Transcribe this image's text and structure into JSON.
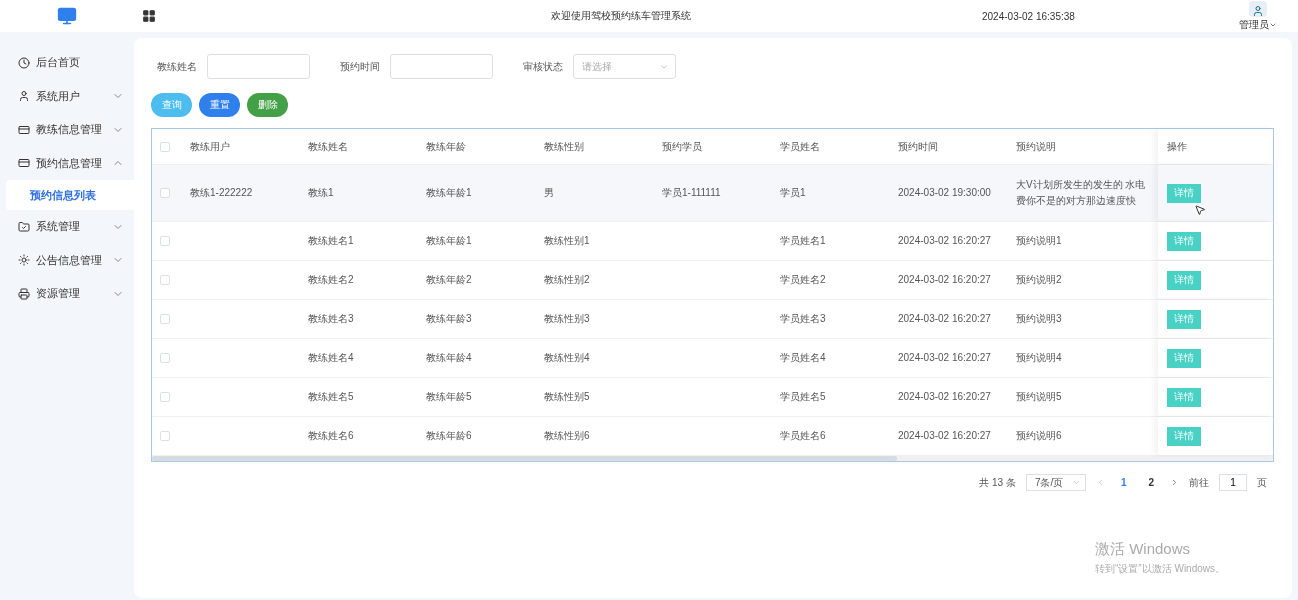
{
  "header": {
    "title": "欢迎使用驾校预约练车管理系统",
    "datetime": "2024-03-02 16:35:38",
    "user": "管理员"
  },
  "sidebar": {
    "items": [
      {
        "label": "后台首页"
      },
      {
        "label": "系统用户",
        "expanded": false
      },
      {
        "label": "教练信息管理",
        "expanded": false
      },
      {
        "label": "预约信息管理",
        "expanded": true,
        "children": [
          {
            "label": "预约信息列表",
            "selected": true
          }
        ]
      },
      {
        "label": "系统管理",
        "expanded": false
      },
      {
        "label": "公告信息管理",
        "expanded": false
      },
      {
        "label": "资源管理",
        "expanded": false
      }
    ]
  },
  "filters": [
    {
      "label": "教练姓名",
      "kind": "text"
    },
    {
      "label": "预约时间",
      "kind": "text"
    },
    {
      "label": "审核状态",
      "kind": "select",
      "placeholder": "请选择"
    }
  ],
  "buttons": [
    {
      "label": "查询",
      "color": "#4dbdf0"
    },
    {
      "label": "重置",
      "color": "#2f80ed"
    },
    {
      "label": "删除",
      "color": "#43a047"
    }
  ],
  "table": {
    "all_checked": false,
    "columns": [
      "教练用户",
      "教练姓名",
      "教练年龄",
      "教练性别",
      "预约学员",
      "学员姓名",
      "预约时间",
      "预约说明"
    ],
    "action_column": "操作",
    "rows": [
      {
        "checked": false,
        "cells": [
          "教练1-222222",
          "教练1",
          "教练年龄1",
          "男",
          "学员1-111111",
          "学员1",
          "2024-03-02 19:30:00",
          "大V计划所发生的发生的 水电费你不是的对方那边速度快"
        ],
        "action": "详情"
      },
      {
        "checked": false,
        "cells": [
          "",
          "教练姓名1",
          "教练年龄1",
          "教练性别1",
          "",
          "学员姓名1",
          "2024-03-02 16:20:27",
          "预约说明1"
        ],
        "action": "详情"
      },
      {
        "checked": false,
        "cells": [
          "",
          "教练姓名2",
          "教练年龄2",
          "教练性别2",
          "",
          "学员姓名2",
          "2024-03-02 16:20:27",
          "预约说明2"
        ],
        "action": "详情"
      },
      {
        "checked": false,
        "cells": [
          "",
          "教练姓名3",
          "教练年龄3",
          "教练性别3",
          "",
          "学员姓名3",
          "2024-03-02 16:20:27",
          "预约说明3"
        ],
        "action": "详情"
      },
      {
        "checked": false,
        "cells": [
          "",
          "教练姓名4",
          "教练年龄4",
          "教练性别4",
          "",
          "学员姓名4",
          "2024-03-02 16:20:27",
          "预约说明4"
        ],
        "action": "详情"
      },
      {
        "checked": false,
        "cells": [
          "",
          "教练姓名5",
          "教练年龄5",
          "教练性别5",
          "",
          "学员姓名5",
          "2024-03-02 16:20:27",
          "预约说明5"
        ],
        "action": "详情"
      },
      {
        "checked": false,
        "cells": [
          "",
          "教练姓名6",
          "教练年龄6",
          "教练性别6",
          "",
          "学员姓名6",
          "2024-03-02 16:20:27",
          "预约说明6"
        ],
        "action": "详情"
      }
    ]
  },
  "pagination": {
    "total": "共 13 条",
    "page_size": "7条/页",
    "pages": [
      {
        "label": "1",
        "selected": true
      },
      {
        "label": "2",
        "selected": false
      }
    ],
    "goto_label": "前往",
    "goto_value": "1",
    "goto_suffix": "页"
  },
  "os_notice": {
    "title": "激活 Windows",
    "text": "转到“设置”以激活 Windows。"
  }
}
